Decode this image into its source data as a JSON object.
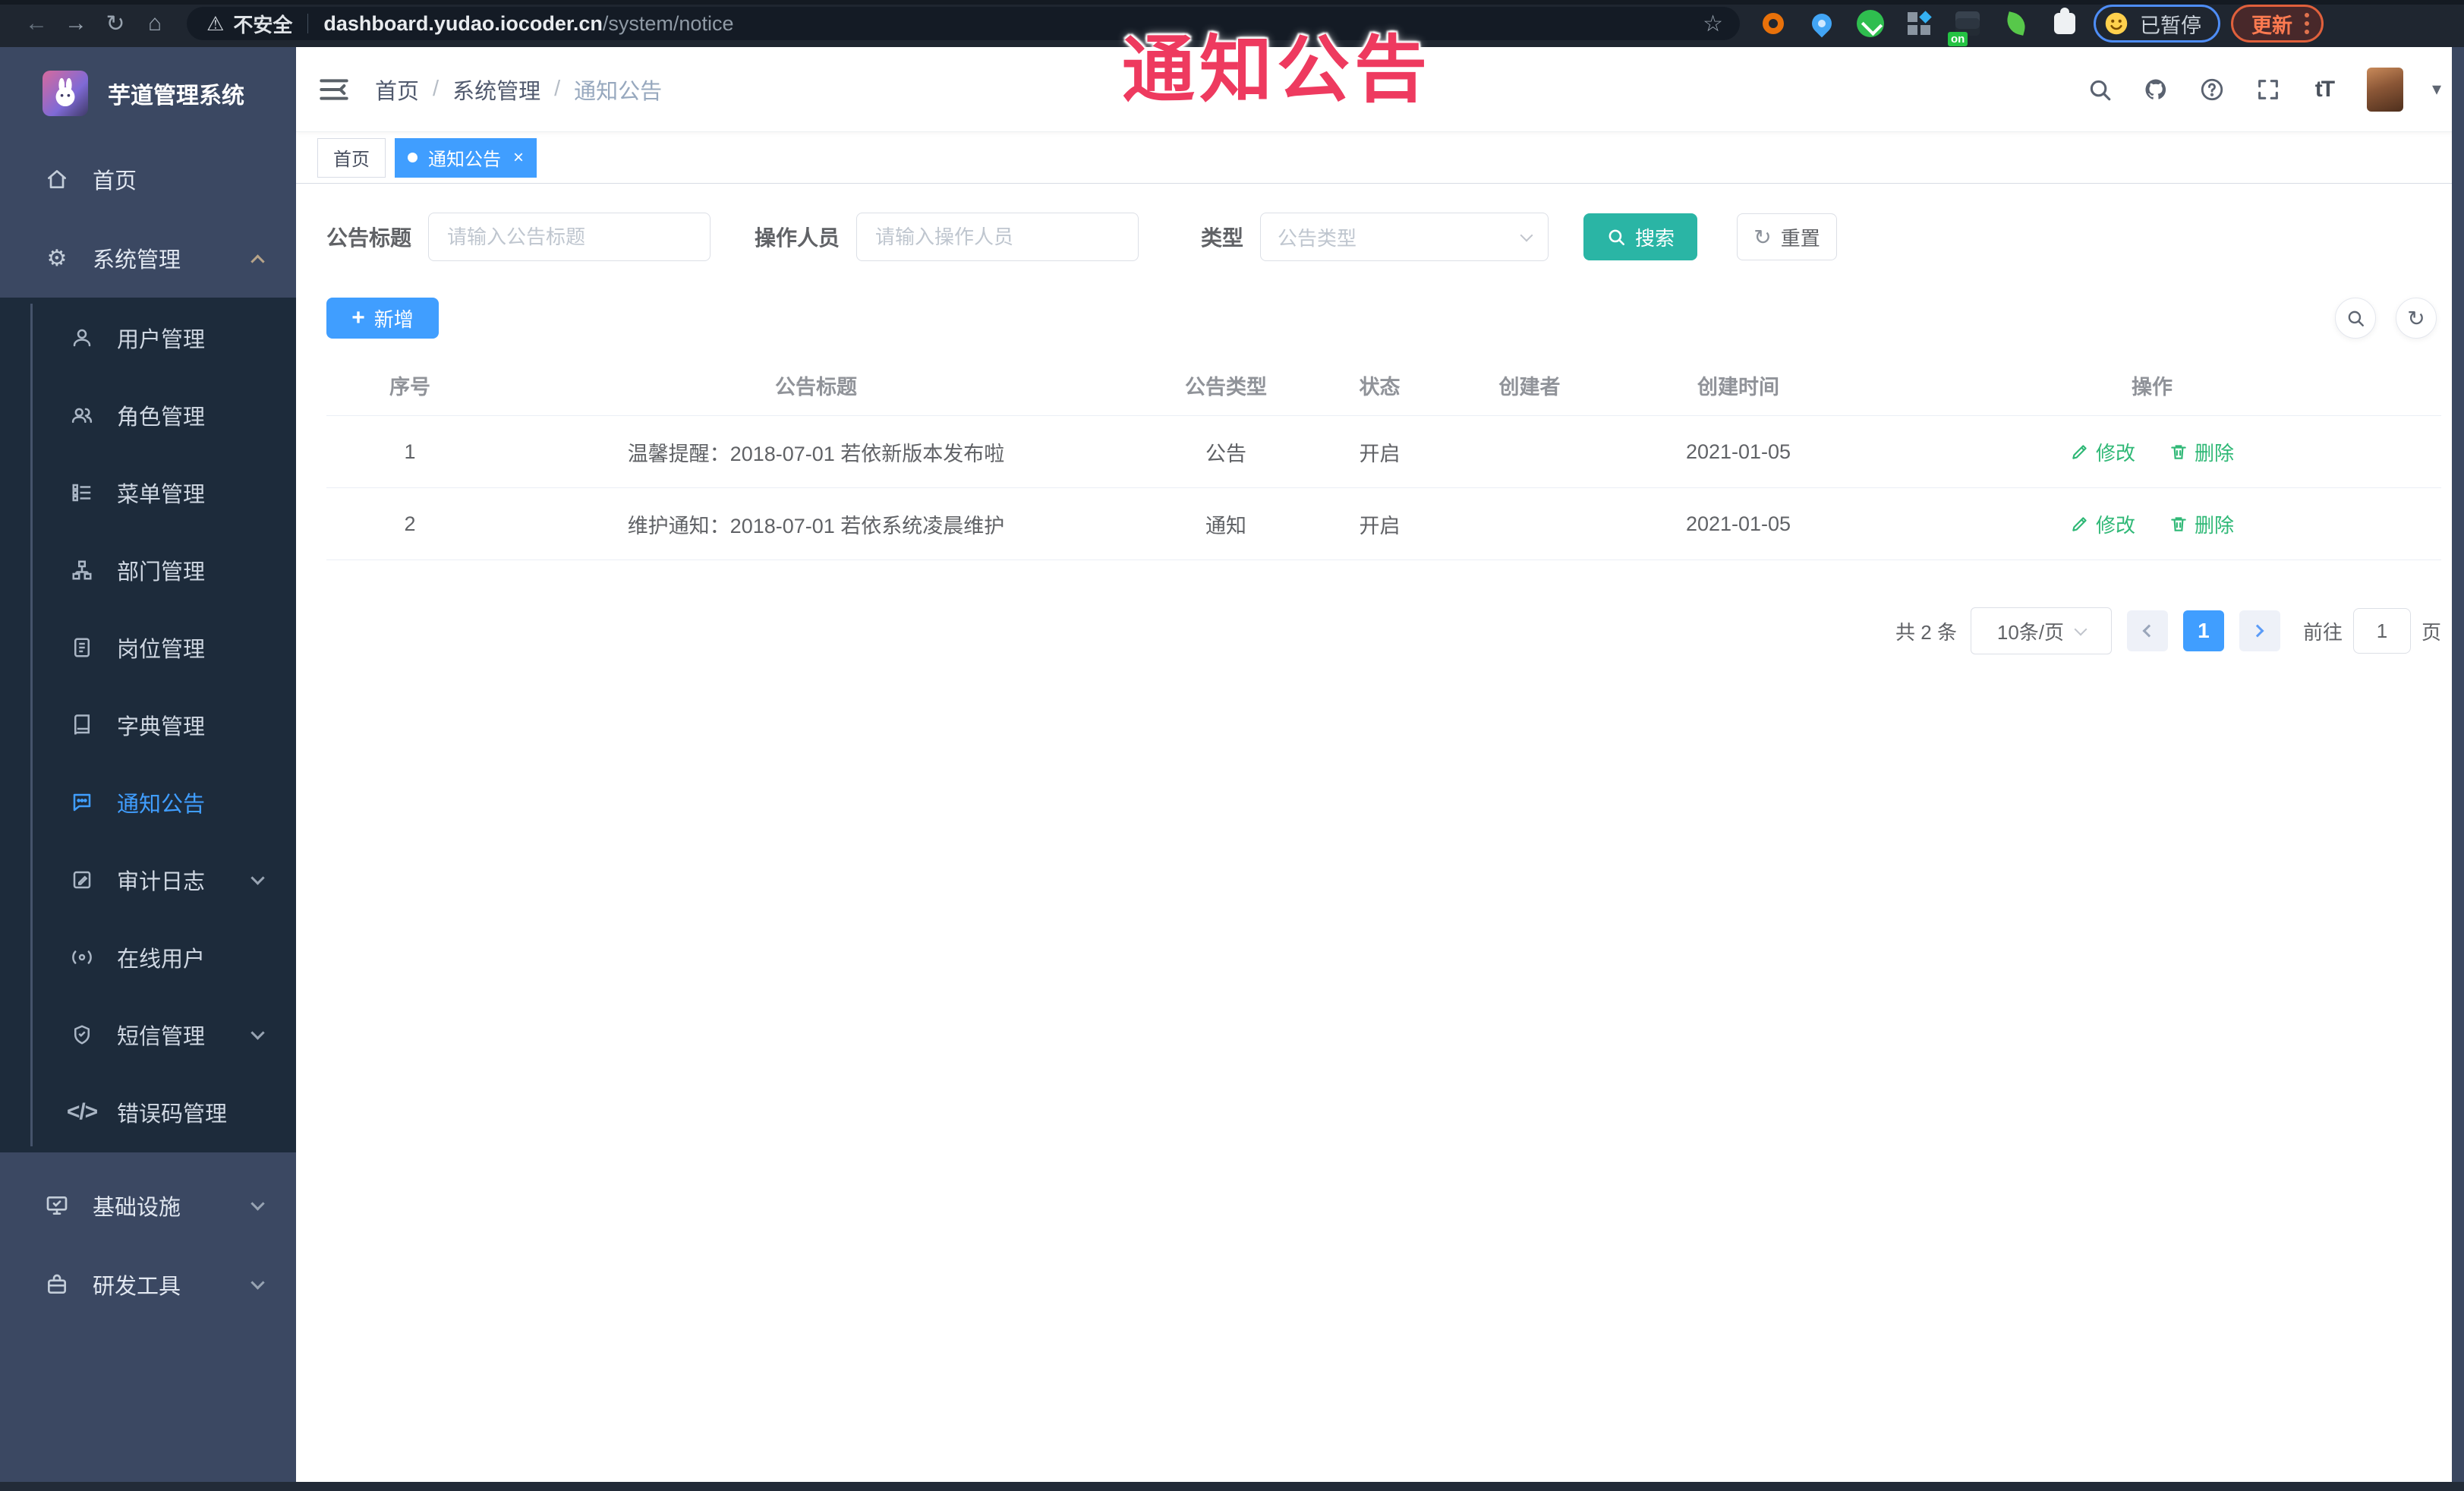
{
  "browser": {
    "security": "不安全",
    "url_host": "dashboard.yudao.iocoder.cn",
    "url_path": "/system/notice",
    "paused": "已暂停",
    "update": "更新",
    "ext_on_badge": "on"
  },
  "icons": {
    "back": "←",
    "forward": "→",
    "reload": "↻",
    "home_glyph": "⌂",
    "warning": "⚠",
    "star": "☆",
    "gear": "⚙",
    "code": "</>",
    "question": "?",
    "fontsize": "tT",
    "caret": "▾",
    "close": "×",
    "plus": "+",
    "refresh": "↻"
  },
  "annotation": {
    "text": "通知公告"
  },
  "sidebar": {
    "title": "芋道管理系统",
    "home": "首页",
    "system": "系统管理",
    "sub": [
      "用户管理",
      "角色管理",
      "菜单管理",
      "部门管理",
      "岗位管理",
      "字典管理",
      "通知公告",
      "审计日志",
      "在线用户",
      "短信管理",
      "错误码管理"
    ],
    "infra": "基础设施",
    "dev": "研发工具"
  },
  "header": {
    "breadcrumb": [
      "首页",
      "系统管理",
      "通知公告"
    ],
    "sep": "/"
  },
  "tabs": {
    "home": "首页",
    "active": "通知公告"
  },
  "filters": {
    "title_label": "公告标题",
    "title_placeholder": "请输入公告标题",
    "operator_label": "操作人员",
    "operator_placeholder": "请输入操作人员",
    "type_label": "类型",
    "type_placeholder": "公告类型",
    "search": "搜索",
    "reset": "重置"
  },
  "toolbar": {
    "add": "新增"
  },
  "table": {
    "columns": [
      "序号",
      "公告标题",
      "公告类型",
      "状态",
      "创建者",
      "创建时间",
      "操作"
    ],
    "edit": "修改",
    "del": "删除",
    "rows": [
      {
        "seq": "1",
        "title": "温馨提醒：2018-07-01 若依新版本发布啦",
        "type": "公告",
        "status": "开启",
        "creator": "",
        "time": "2021-01-05"
      },
      {
        "seq": "2",
        "title": "维护通知：2018-07-01 若依系统凌晨维护",
        "type": "通知",
        "status": "开启",
        "creator": "",
        "time": "2021-01-05"
      }
    ]
  },
  "pagination": {
    "total": "共 2 条",
    "size": "10条/页",
    "page": "1",
    "goto_label": "前往",
    "goto_value": "1",
    "unit": "页"
  },
  "colors": {
    "accent": "#409eff",
    "search_button": "#2ab5a5",
    "operation_link": "#2fb876",
    "annotation": "#ee3a5f",
    "sidebar_bg": "#3b4862",
    "submenu_bg": "#1d2b3b"
  }
}
